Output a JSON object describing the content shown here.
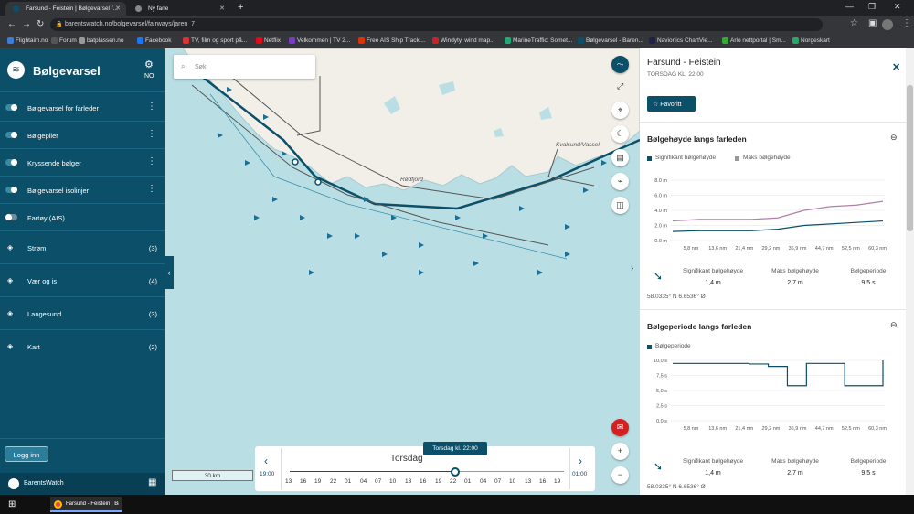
{
  "browser": {
    "tabs": [
      {
        "title": "Farsund - Feistein | Bølgevarsel f...",
        "active": true
      },
      {
        "title": "Ny fane",
        "active": false
      }
    ],
    "new_tab": "+",
    "url": "barentswatch.no/bolgevarsel/fairways/jaren_7",
    "bookmarks": [
      "Flightaim.no",
      "Forum",
      "batplassen.no",
      "Facebook",
      "TV, film og sport på...",
      "Netflix",
      "Velkommen | TV 2...",
      "Free AIS Ship Tracki...",
      "Windyty, wind map...",
      "MarineTraffic: Somet...",
      "Bølgevarsel - Baren...",
      "Navionics ChartVie...",
      "Arlo nettportal | Sm...",
      "Norgeskart"
    ]
  },
  "sidebar": {
    "title": "Bølgevarsel",
    "lang": "NO",
    "toggles": [
      {
        "label": "Bølgevarsel for farleder",
        "on": true
      },
      {
        "label": "Bølgepiler",
        "on": true
      },
      {
        "label": "Kryssende bølger",
        "on": true
      },
      {
        "label": "Bølgevarsel isolinjer",
        "on": true
      },
      {
        "label": "Fartøy (AIS)",
        "on": false
      }
    ],
    "groups": [
      {
        "label": "Strøm",
        "count": "(3)"
      },
      {
        "label": "Vær og is",
        "count": "(4)"
      },
      {
        "label": "Langesund",
        "count": "(3)"
      },
      {
        "label": "Kart",
        "count": "(2)"
      }
    ],
    "login": "Logg inn",
    "brand": "BarentsWatch"
  },
  "map": {
    "search_placeholder": "Søk",
    "places": [
      "Kvalsund/Vassel",
      "Rødfjord"
    ],
    "scale": "30 km",
    "timeline": {
      "day": "Torsdag",
      "bubble": "Torsdag kl. 22:00",
      "start": "19:00",
      "end": "01:00",
      "ticks": [
        "13",
        "16",
        "19",
        "22",
        "01",
        "04",
        "07",
        "10",
        "13",
        "16",
        "19",
        "22",
        "01",
        "04",
        "07",
        "10",
        "13",
        "16",
        "19"
      ]
    }
  },
  "panel": {
    "title": "Farsund - Feistein",
    "subtitle": "TORSDAG KL. 22:00",
    "favorite": "Favoritt",
    "sections": [
      {
        "title": "Bølgehøyde langs farleden",
        "legend": [
          "Signifikant bølgehøyde",
          "Maks bølgehøyde"
        ],
        "stats": [
          {
            "label": "Signifikant bølgehøyde",
            "value": "1,4 m"
          },
          {
            "label": "Maks bølgehøyde",
            "value": "2,7 m"
          },
          {
            "label": "Bølgeperiode",
            "value": "9,5 s"
          }
        ],
        "coords": "58.0335° N 6.6536° Ø"
      },
      {
        "title": "Bølgeperiode langs farleden",
        "legend": [
          "Bølgeperiode"
        ],
        "stats": [
          {
            "label": "Signifikant bølgehøyde",
            "value": "1,4 m"
          },
          {
            "label": "Maks bølgehøyde",
            "value": "2,7 m"
          },
          {
            "label": "Bølgeperiode",
            "value": "9,5 s"
          }
        ],
        "coords": "58.0335° N 6.6536° Ø"
      }
    ]
  },
  "chart_data": [
    {
      "type": "line",
      "title": "Bølgehøyde langs farleden",
      "x": [
        "5,8 nm",
        "13,6 nm",
        "21,4 nm",
        "29,2 nm",
        "36,9 nm",
        "44,7 nm",
        "52,5 nm",
        "60,3 nm"
      ],
      "y_ticks": [
        "0.0 m",
        "2.0 m",
        "4.0 m",
        "6.0 m",
        "8.0 m"
      ],
      "ylim": [
        0,
        8
      ],
      "series": [
        {
          "name": "Signifikant bølgehøyde",
          "color": "#0b4f69",
          "values": [
            1.2,
            1.3,
            1.3,
            1.3,
            1.5,
            2.0,
            2.2,
            2.4,
            2.6
          ]
        },
        {
          "name": "Maks bølgehøyde",
          "color": "#b07fa8",
          "values": [
            2.6,
            2.8,
            2.8,
            2.8,
            3.0,
            4.0,
            4.5,
            4.7,
            5.2
          ]
        }
      ]
    },
    {
      "type": "line",
      "title": "Bølgeperiode langs farleden",
      "x": [
        "5,8 nm",
        "13,6 nm",
        "21,4 nm",
        "29,2 nm",
        "36,9 nm",
        "44,7 nm",
        "52,5 nm",
        "60,3 nm"
      ],
      "y_ticks": [
        "0,0 s",
        "2,5 s",
        "5,0 s",
        "7,5 s",
        "10,0 s"
      ],
      "ylim": [
        0,
        10
      ],
      "series": [
        {
          "name": "Bølgeperiode",
          "color": "#0b4f69",
          "values": [
            9.5,
            9.5,
            9.5,
            9.5,
            9.4,
            9.0,
            5.8,
            9.5,
            9.5,
            5.8,
            5.8,
            10.0
          ]
        }
      ]
    }
  ]
}
